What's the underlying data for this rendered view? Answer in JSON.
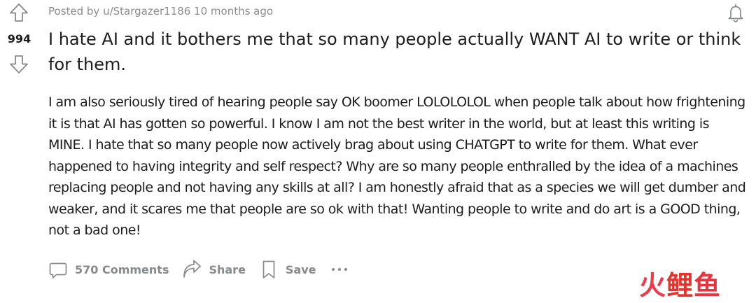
{
  "post": {
    "score": "994",
    "meta": "Posted by u/Stargazer1186 10 months ago",
    "title": "I hate AI and it bothers me that so many people actually WANT AI to write or think for them.",
    "body": "I am also seriously tired of hearing people say OK boomer LOLOLOLOL when people talk about how frightening it is that AI has gotten so powerful. I know I am not the best writer in the world, but at least this writing is MINE. I hate that so many people now actively brag about using CHATGPT to write for them. What ever happened to having integrity and self respect? Why are so many people enthralled by the idea of a machines replacing people and not having any skills at all? I am honestly afraid that as a species we will get dumber and weaker, and it scares me that people are so ok with that! Wanting people to write and do art is a GOOD thing, not a bad one!"
  },
  "actions": {
    "comments_label": "570 Comments",
    "share_label": "Share",
    "save_label": "Save"
  },
  "icons": {
    "upvote": "arrow-up-outline-icon",
    "downvote": "arrow-down-outline-icon",
    "notify": "bell-icon",
    "comments": "speech-bubble-icon",
    "share": "share-arrow-icon",
    "save": "bookmark-icon",
    "more": "ellipsis-icon"
  },
  "watermark": {
    "char1": "火",
    "char2": "鲤",
    "char3": "鱼"
  },
  "colors": {
    "text": "#1c1c1c",
    "meta": "#8a8c8e",
    "action": "#878a8c",
    "icon": "#878a8c",
    "watermark_red": "#e8343e"
  }
}
